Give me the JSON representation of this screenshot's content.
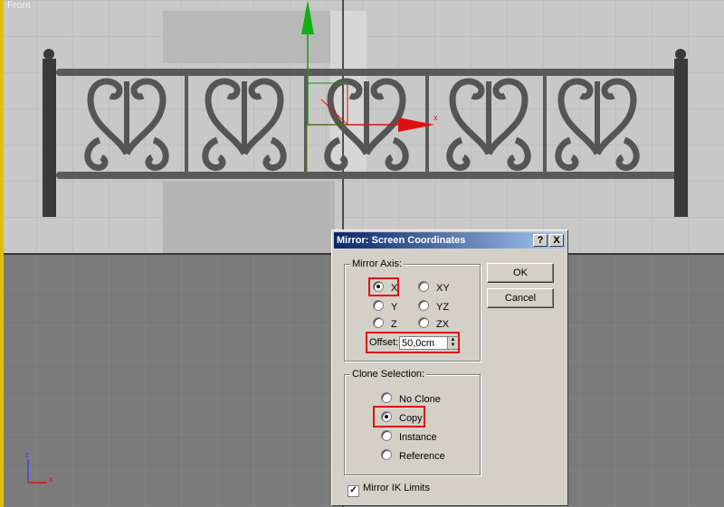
{
  "viewport": {
    "label": "Front",
    "gizmo_axis_label": "x",
    "tripod": {
      "z_label": "z",
      "x_label": "x"
    },
    "colors": {
      "upper_bg": "#c6c6c6",
      "lower_bg": "#7b7b7b",
      "grid": "#b0b0b0",
      "x_axis": "#e01010",
      "y_axis": "#10a010"
    }
  },
  "dialog": {
    "title": "Mirror: Screen Coordinates",
    "help_label": "?",
    "close_label": "X",
    "mirror_axis": {
      "title": "Mirror Axis:",
      "options": [
        {
          "label": "X",
          "selected": true
        },
        {
          "label": "XY",
          "selected": false
        },
        {
          "label": "Y",
          "selected": false
        },
        {
          "label": "YZ",
          "selected": false
        },
        {
          "label": "Z",
          "selected": false
        },
        {
          "label": "ZX",
          "selected": false
        }
      ],
      "offset_label": "Offset:",
      "offset_value": "50,0cm"
    },
    "clone_selection": {
      "title": "Clone Selection:",
      "options": [
        {
          "label": "No Clone",
          "selected": false
        },
        {
          "label": "Copy",
          "selected": true
        },
        {
          "label": "Instance",
          "selected": false
        },
        {
          "label": "Reference",
          "selected": false
        }
      ]
    },
    "mirror_ik": {
      "label": "Mirror IK Limits",
      "checked": true
    },
    "ok_label": "OK",
    "cancel_label": "Cancel",
    "highlight_color": "#e01010"
  }
}
